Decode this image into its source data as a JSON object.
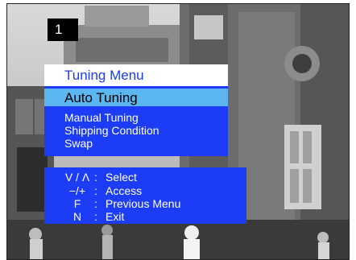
{
  "screen": {
    "channel_number": "1"
  },
  "menu": {
    "title": "Tuning Menu",
    "selected_item": "Auto Tuning",
    "items": [
      "Manual Tuning",
      "Shipping Condition",
      "Swap"
    ]
  },
  "help": {
    "rows": [
      {
        "key": "V / Λ",
        "colon": ":",
        "action": "Select"
      },
      {
        "key": "−/+",
        "colon": ":",
        "action": "Access"
      },
      {
        "key": "F",
        "colon": ":",
        "action": "Previous Menu"
      },
      {
        "key": "N",
        "colon": ":",
        "action": "Exit"
      }
    ]
  },
  "colors": {
    "menu_blue": "#1c3cf5",
    "highlight": "#5cb6ef",
    "title_background": "#ffffff"
  }
}
